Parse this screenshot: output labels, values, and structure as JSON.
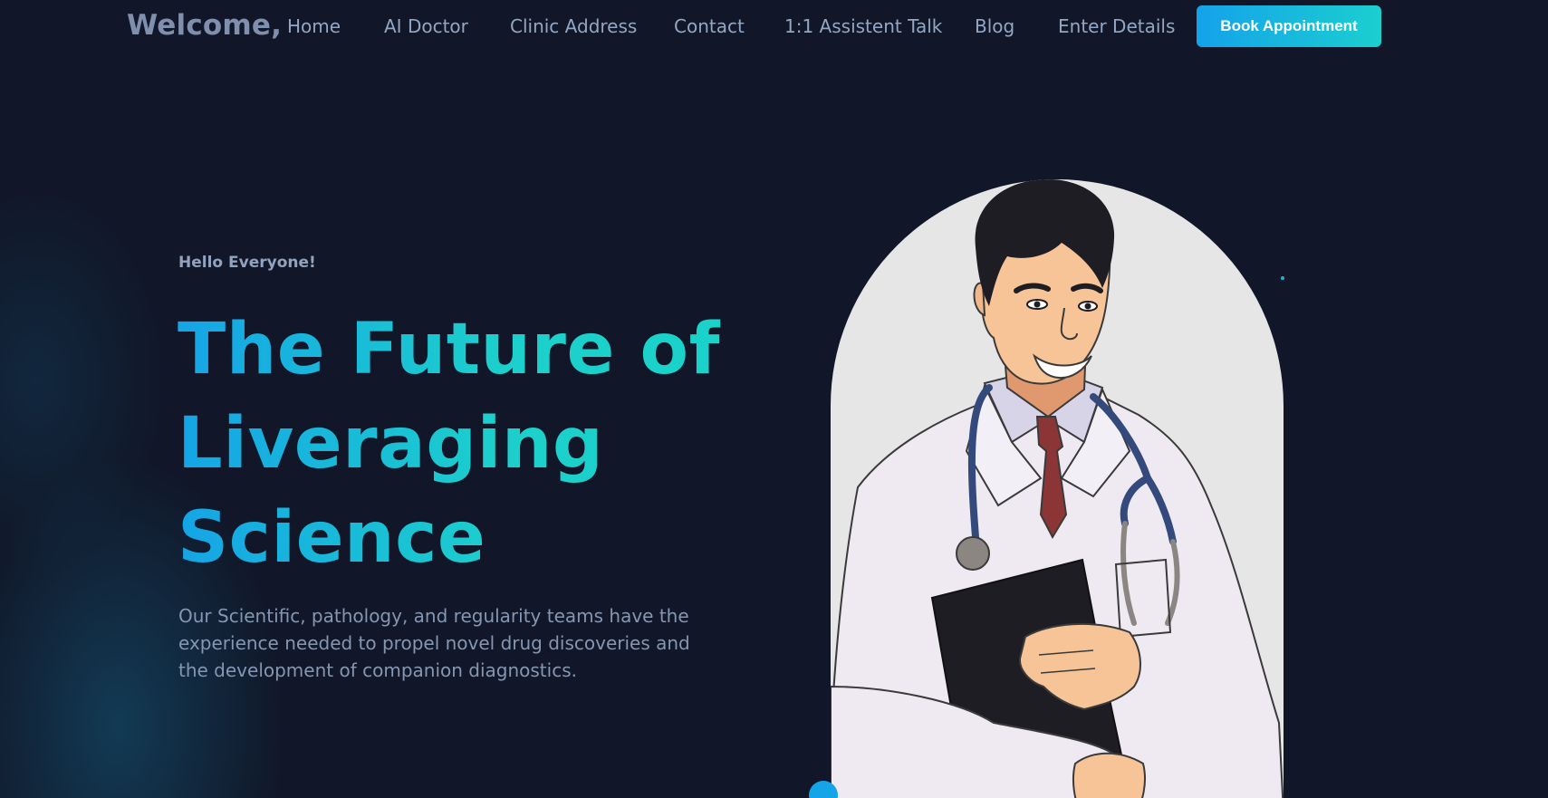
{
  "navbar": {
    "brand": "Welcome,",
    "links": [
      {
        "label": "Home"
      },
      {
        "label": "AI Doctor"
      },
      {
        "label": "Clinic Address"
      },
      {
        "label": "Contact"
      },
      {
        "label": "1:1 Assistent Talk"
      },
      {
        "label": "Blog"
      },
      {
        "label": "Enter Details"
      }
    ],
    "cta_label": "Book Appointment"
  },
  "hero": {
    "eyebrow": "Hello Everyone!",
    "title_lines": [
      "The Future of",
      "Liveraging",
      "Science"
    ],
    "description": "Our Scientific, pathology, and regularity teams have the experience needed to propel novel drug discoveries and the development of companion diagnostics."
  },
  "image": {
    "subject": "doctor-illustration"
  },
  "colors": {
    "background": "#111729",
    "accent_start": "#14a2ea",
    "accent_end": "#1bcfcf",
    "nav_text": "#93a7c4",
    "body_text": "#8496b2"
  }
}
